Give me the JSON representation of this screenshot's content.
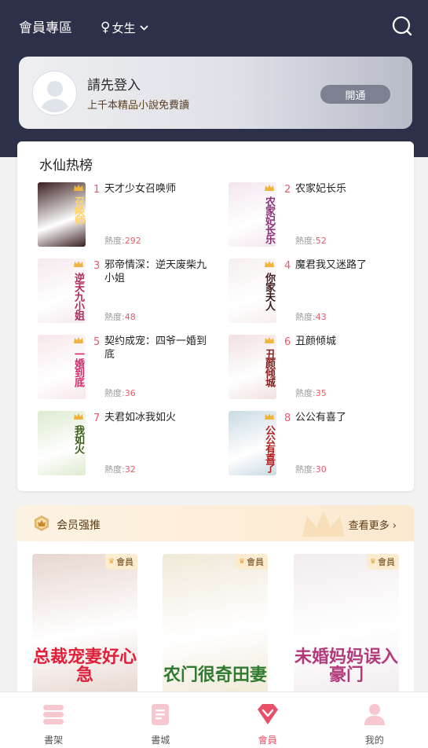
{
  "header": {
    "title": "會員專區",
    "gender_label": "女生",
    "gender_icon": "female-symbol-icon"
  },
  "login": {
    "title": "請先登入",
    "subtitle": "上千本精品小說免費讀",
    "button_label": "開通"
  },
  "ranking": {
    "title": "水仙热榜",
    "heat_label": "熱度:",
    "items": [
      {
        "rank": "1",
        "name": "天才少女召唤师",
        "heat": "292",
        "cover_text": "召唤师",
        "cover_bg": "#3a1f1f",
        "cover_fg": "#ffd36b"
      },
      {
        "rank": "2",
        "name": "农家妃长乐",
        "heat": "52",
        "cover_text": "农家妃长乐",
        "cover_bg": "#f3e6ef",
        "cover_fg": "#8b2f7a"
      },
      {
        "rank": "3",
        "name": "邪帝情深：逆天废柴九小姐",
        "heat": "48",
        "cover_text": "逆天九小姐",
        "cover_bg": "#f4e9ee",
        "cover_fg": "#b0285a"
      },
      {
        "rank": "4",
        "name": "魔君我又迷路了",
        "heat": "43",
        "cover_text": "你家夫人",
        "cover_bg": "#f6eeee",
        "cover_fg": "#3a1a1a"
      },
      {
        "rank": "5",
        "name": "契约成宠：四爷一婚到底",
        "heat": "36",
        "cover_text": "一婚到底",
        "cover_bg": "#f7e7ea",
        "cover_fg": "#d4286a"
      },
      {
        "rank": "6",
        "name": "丑颜倾城",
        "heat": "35",
        "cover_text": "丑颜倾城",
        "cover_bg": "#f1e0e0",
        "cover_fg": "#8a1d1d"
      },
      {
        "rank": "7",
        "name": "夫君如冰我如火",
        "heat": "32",
        "cover_text": "我如火",
        "cover_bg": "#dcebcf",
        "cover_fg": "#3d5a1a"
      },
      {
        "rank": "8",
        "name": "公公有喜了",
        "heat": "30",
        "cover_text": "公公有喜了",
        "cover_bg": "#c9dbe3",
        "cover_fg": "#b52020"
      }
    ]
  },
  "vip": {
    "title": "会员强推",
    "more_label": "查看更多",
    "member_tag": "會員",
    "books": [
      {
        "cover_text": "总裁宠妻好心急",
        "bg": "#e7d6cf",
        "fg": "#e0203a"
      },
      {
        "cover_text": "农门很奇田妻",
        "bg": "#f0e9d8",
        "fg": "#2e7a2e"
      },
      {
        "cover_text": "未婚妈妈误入豪门",
        "bg": "#f2ecef",
        "fg": "#b23a7a"
      }
    ]
  },
  "nav": {
    "items": [
      {
        "label": "書架",
        "icon": "bookshelf-icon",
        "active": false
      },
      {
        "label": "書城",
        "icon": "bookstore-icon",
        "active": false
      },
      {
        "label": "會員",
        "icon": "vip-diamond-icon",
        "active": true
      },
      {
        "label": "我的",
        "icon": "profile-icon",
        "active": false
      }
    ]
  },
  "colors": {
    "header_bg": "#2c3049",
    "accent": "#e8506a",
    "vip_gold": "#e8a53b"
  }
}
